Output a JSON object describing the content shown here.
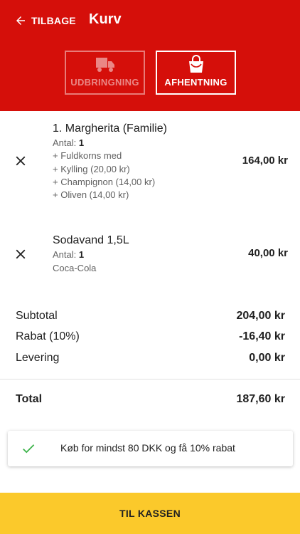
{
  "colors": {
    "header": "#d50f0a",
    "button": "#fbc92b",
    "check": "#3cb34a"
  },
  "header": {
    "back_label": "TILBAGE",
    "title": "Kurv"
  },
  "modes": [
    {
      "label": "UDBRINGNING",
      "icon": "truck-icon",
      "selected": false
    },
    {
      "label": "AFHENTNING",
      "icon": "shopping-bag-icon",
      "selected": true
    }
  ],
  "cart": {
    "items": [
      {
        "name": "1. Margherita (Familie)",
        "qty_label": "Antal:",
        "qty": "1",
        "options": [
          "+ Fuldkorns med",
          "+ Kylling (20,00 kr)",
          "+ Champignon (14,00 kr)",
          "+ Oliven (14,00 kr)"
        ],
        "price": "164,00 kr"
      },
      {
        "name": "Sodavand 1,5L",
        "qty_label": "Antal:",
        "qty": "1",
        "options": [
          "Coca-Cola"
        ],
        "price": "40,00 kr"
      }
    ]
  },
  "summary": {
    "subtotal_label": "Subtotal",
    "subtotal": "204,00 kr",
    "discount_label": "Rabat (10%)",
    "discount": "-16,40 kr",
    "delivery_label": "Levering",
    "delivery": "0,00 kr",
    "total_label": "Total",
    "total": "187,60 kr"
  },
  "promo": {
    "text": "Køb for mindst 80 DKK og få 10% rabat"
  },
  "checkout": {
    "label": "TIL KASSEN"
  }
}
